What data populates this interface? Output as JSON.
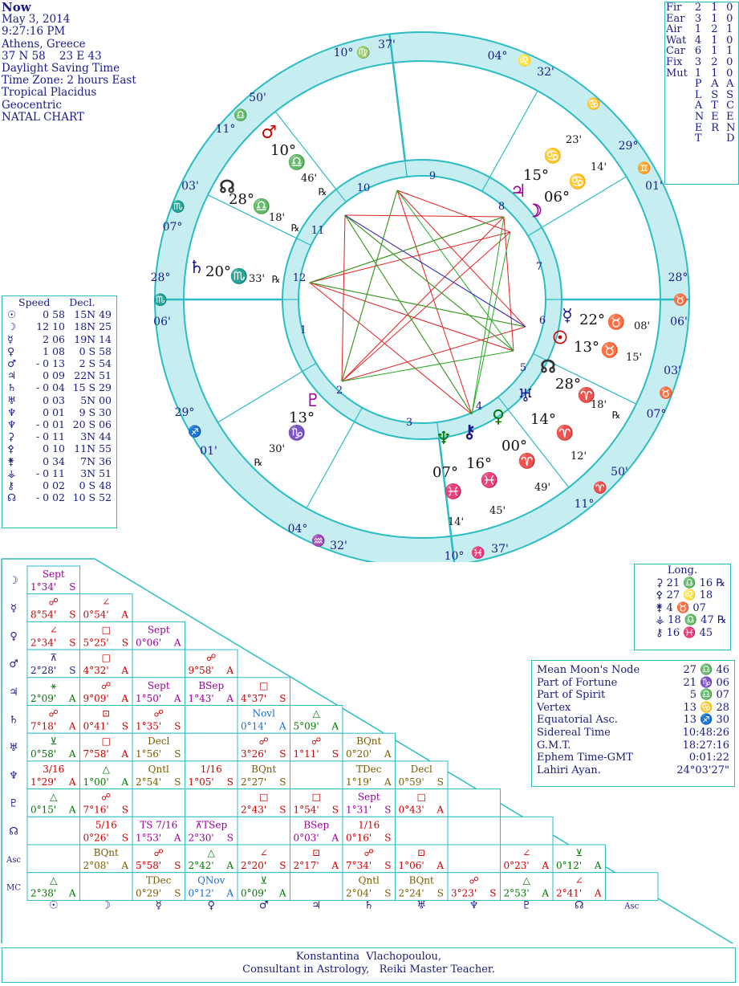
{
  "info": {
    "title": "Now",
    "lines": [
      "May 3, 2014",
      "9:27:16 PM",
      "Athens, Greece",
      "37 N 58    23 E 43",
      "Daylight Saving Time",
      "Time Zone: 2 hours East",
      "Tropical Placidus",
      "Geocentric",
      "NATAL CHART"
    ]
  },
  "elements": {
    "rows": [
      {
        "label": "Fir",
        "a": "2",
        "b": "1",
        "c": "0"
      },
      {
        "label": "Ear",
        "a": "3",
        "b": "1",
        "c": "0"
      },
      {
        "label": "Air",
        "a": "1",
        "b": "2",
        "c": "1"
      },
      {
        "label": "Wat",
        "a": "4",
        "b": "1",
        "c": "0"
      },
      {
        "label": "Car",
        "a": "6",
        "b": "1",
        "c": "1"
      },
      {
        "label": "Fix",
        "a": "3",
        "b": "2",
        "c": "0"
      },
      {
        "label": "Mut",
        "a": "1",
        "b": "1",
        "c": "0"
      }
    ],
    "planet_letters": [
      "P",
      "L",
      "A",
      "N",
      "E",
      "T"
    ],
    "aster_letters": [
      "A",
      "S",
      "T",
      "E",
      "R"
    ],
    "ascend_letters": [
      "A",
      "S",
      "C",
      "E",
      "N",
      "D"
    ]
  },
  "wheel": {
    "outer_labels": [
      {
        "text": "10° ♍ 37'",
        "color": "#1a1a8a"
      },
      {
        "text": "04° ♌ 32'",
        "color": "#1a1a8a"
      },
      {
        "text": "29° ♊ 01'",
        "color": "#1a1a8a"
      },
      {
        "text": "28° ♉ 06'",
        "color": "#1a1a8a"
      },
      {
        "text": "03' ♉ 07°",
        "color": "#1a1a8a"
      },
      {
        "text": "50' ♈ 11°",
        "color": "#1a1a8a"
      },
      {
        "text": "10° ♓ 37'",
        "color": "#1a1a8a"
      },
      {
        "text": "04° ♒ 32'",
        "color": "#1a1a8a"
      },
      {
        "text": "29° ♐ 01'",
        "color": "#1a1a8a"
      },
      {
        "text": "28° ♏ 06'",
        "color": "#1a1a8a"
      },
      {
        "text": "03' ♏ 07°",
        "color": "#1a1a8a"
      },
      {
        "text": "50' ♎ 11°",
        "color": "#1a1a8a"
      }
    ],
    "cusp_texts": [
      "10°",
      "♍",
      "37'",
      "04°",
      "♌",
      "32'",
      "♋",
      "29°",
      "♊",
      "01'",
      "28°",
      "♉",
      "06'",
      "03'",
      "♉",
      "07°",
      "50'",
      "♈",
      "11°",
      "10°",
      "♓",
      "37'",
      "04°",
      "♒",
      "32'",
      "29°",
      "♐",
      "01'",
      "28°",
      "♏",
      "06'",
      "03'",
      "♏",
      "07°",
      "50'",
      "♎",
      "11°"
    ],
    "house_numbers": [
      "1",
      "2",
      "3",
      "4",
      "5",
      "6",
      "7",
      "8",
      "9",
      "10",
      "11",
      "12"
    ],
    "planets": [
      {
        "glyph": "♂",
        "deg": "10°",
        "sign": "♎",
        "min": "46'",
        "retro": "℞",
        "color": "#cc0000"
      },
      {
        "glyph": "☊",
        "deg": "28°",
        "sign": "♎",
        "min": "18'",
        "retro": "℞",
        "color": "#333333"
      },
      {
        "glyph": "♄",
        "deg": "20°",
        "sign": "♏",
        "min": "33'",
        "retro": "℞",
        "color": "#1a1a8a"
      },
      {
        "glyph": "♇",
        "deg": "13°",
        "sign": "♑",
        "min": "30'",
        "retro": "℞",
        "color": "#990099"
      },
      {
        "glyph": "♆",
        "deg": "07°",
        "sign": "♓",
        "min": "14'",
        "retro": "",
        "color": "#007700"
      },
      {
        "glyph": "⚷",
        "deg": "16°",
        "sign": "♓",
        "min": "45'",
        "retro": "",
        "color": "#1a1a8a"
      },
      {
        "glyph": "♀",
        "deg": "00°",
        "sign": "♈",
        "min": "49'",
        "retro": "",
        "color": "#007700"
      },
      {
        "glyph": "♅",
        "deg": "14°",
        "sign": "♈",
        "min": "12'",
        "retro": "",
        "color": "#1a1a8a"
      },
      {
        "glyph": "☊",
        "deg": "28°",
        "sign": "♈",
        "min": "18'",
        "retro": "℞",
        "color": "#333333"
      },
      {
        "glyph": "☉",
        "deg": "13°",
        "sign": "♉",
        "min": "15'",
        "retro": "",
        "color": "#cc0000"
      },
      {
        "glyph": "☿",
        "deg": "22°",
        "sign": "♉",
        "min": "08'",
        "retro": "",
        "color": "#1a1a8a"
      },
      {
        "glyph": "☽",
        "deg": "06°",
        "sign": "♋",
        "min": "14'",
        "retro": "",
        "color": "#990099"
      },
      {
        "glyph": "♃",
        "deg": "15°",
        "sign": "♋",
        "min": "23'",
        "retro": "",
        "color": "#990099"
      }
    ]
  },
  "speed": {
    "headers": [
      "Speed",
      "Decl."
    ],
    "rows": [
      {
        "glyph": "☉",
        "speed": "0 58",
        "decl": "15N 49"
      },
      {
        "glyph": "☽",
        "speed": "12 10",
        "decl": "18N 25"
      },
      {
        "glyph": "☿",
        "speed": "2 06",
        "decl": "19N 14"
      },
      {
        "glyph": "♀",
        "speed": "1 08",
        "decl": "0 S 58"
      },
      {
        "glyph": "♂",
        "speed": "- 0 13",
        "decl": "2 S 54"
      },
      {
        "glyph": "♃",
        "speed": "0 09",
        "decl": "22N 51"
      },
      {
        "glyph": "♄",
        "speed": "- 0 04",
        "decl": "15 S 29"
      },
      {
        "glyph": "♅",
        "speed": "0 03",
        "decl": "5N 00"
      },
      {
        "glyph": "♆",
        "speed": "0 01",
        "decl": "9 S 30"
      },
      {
        "glyph": "♆",
        "speed": "- 0 01",
        "decl": "20 S 06"
      },
      {
        "glyph": "⚳",
        "speed": "- 0 11",
        "decl": "3N 44"
      },
      {
        "glyph": "⚴",
        "speed": "0 10",
        "decl": "11N 55"
      },
      {
        "glyph": "⚵",
        "speed": "0 34",
        "decl": "7N 36"
      },
      {
        "glyph": "⚶",
        "speed": "- 0 11",
        "decl": "3N 51"
      },
      {
        "glyph": "⚷",
        "speed": "0 02",
        "decl": "0 S 48"
      },
      {
        "glyph": "☊",
        "speed": "- 0 02",
        "decl": "10 S 52"
      }
    ]
  },
  "long": {
    "title": "Long.",
    "rows": [
      {
        "glyph": "⚳",
        "value": "21 ♎ 16 ℞"
      },
      {
        "glyph": "⚴",
        "value": "27 ♌ 18"
      },
      {
        "glyph": "⚵",
        "value": "4 ♉ 07"
      },
      {
        "glyph": "⚶",
        "value": "18 ♎ 47 ℞"
      },
      {
        "glyph": "⚷",
        "value": "16 ♓ 45"
      }
    ]
  },
  "misc": [
    {
      "label": "Mean Moon's Node",
      "value": "27 ♎ 46"
    },
    {
      "label": "Part of Fortune",
      "value": "21 ♑ 06"
    },
    {
      "label": "Part of Spirit",
      "value": "5 ♎ 07"
    },
    {
      "label": "Vertex",
      "value": "13 ♋ 28"
    },
    {
      "label": "Equatorial Asc.",
      "value": "13 ♐ 30"
    },
    {
      "label": "Sidereal Time",
      "value": "10:48:26"
    },
    {
      "label": "G.M.T.",
      "value": "18:27:16"
    },
    {
      "label": "Ephem Time-GMT",
      "value": "0:01:22"
    },
    {
      "label": "Lahiri Ayan.",
      "value": "24°03'27\""
    }
  ],
  "aspect_grid": {
    "row_glyphs": [
      "☽",
      "☿",
      "♀",
      "♂",
      "♃",
      "♄",
      "♅",
      "♆",
      "♇",
      "☊",
      "Asc",
      "MC"
    ],
    "col_glyphs": [
      "☉",
      "☽",
      "☿",
      "♀",
      "♂",
      "♃",
      "♄",
      "♅",
      "♆",
      "♇",
      "☊",
      "Asc"
    ],
    "cells": [
      [
        {
          "a": "Sept",
          "o": "1°34'",
          "t": "S",
          "c": "#990099"
        }
      ],
      [
        {
          "a": "☍",
          "o": "8°54'",
          "t": "S",
          "c": "#cc0000"
        },
        {
          "a": "∠",
          "o": "0°54'",
          "t": "A",
          "c": "#cc0000"
        }
      ],
      [
        {
          "a": "∠",
          "o": "2°34'",
          "t": "S",
          "c": "#cc0000"
        },
        {
          "a": "□",
          "o": "5°25'",
          "t": "S",
          "c": "#cc0000"
        },
        {
          "a": "Sept",
          "o": "0°06'",
          "t": "A",
          "c": "#990099"
        }
      ],
      [
        {
          "a": "⊼",
          "o": "2°28'",
          "t": "S",
          "c": "#1a1a8a"
        },
        {
          "a": "□",
          "o": "4°32'",
          "t": "A",
          "c": "#cc0000"
        },
        null,
        {
          "a": "☍",
          "o": "9°58'",
          "t": "A",
          "c": "#cc0000"
        }
      ],
      [
        {
          "a": "⚹",
          "o": "2°09'",
          "t": "A",
          "c": "#007700"
        },
        {
          "a": "☍",
          "o": "9°09'",
          "t": "A",
          "c": "#cc0000"
        },
        {
          "a": "Sept",
          "o": "1°50'",
          "t": "A",
          "c": "#990099"
        },
        {
          "a": "BSep",
          "o": "1°43'",
          "t": "A",
          "c": "#990099"
        },
        {
          "a": "□",
          "o": "4°37'",
          "t": "S",
          "c": "#cc0000"
        }
      ],
      [
        {
          "a": "☍",
          "o": "7°18'",
          "t": "A",
          "c": "#cc0000"
        },
        {
          "a": "⊡",
          "o": "0°41'",
          "t": "S",
          "c": "#cc0000"
        },
        {
          "a": "☍",
          "o": "1°35'",
          "t": "S",
          "c": "#cc0000"
        },
        null,
        {
          "a": "Novl",
          "o": "0°14'",
          "t": "A",
          "c": "#1a6acc"
        },
        {
          "a": "△",
          "o": "5°09'",
          "t": "A",
          "c": "#007700"
        }
      ],
      [
        {
          "a": "⊻",
          "o": "0°58'",
          "t": "A",
          "c": "#007700"
        },
        {
          "a": "□",
          "o": "7°58'",
          "t": "A",
          "c": "#cc0000"
        },
        {
          "a": "Decl",
          "o": "1°56'",
          "t": "S",
          "c": "#7a5a00"
        },
        null,
        {
          "a": "☍",
          "o": "3°26'",
          "t": "S",
          "c": "#cc0000"
        },
        {
          "a": "☍",
          "o": "1°11'",
          "t": "S",
          "c": "#cc0000"
        },
        {
          "a": "BQnt",
          "o": "0°20'",
          "t": "A",
          "c": "#7a5a00"
        }
      ],
      [
        {
          "a": "3/16",
          "o": "1°29'",
          "t": "A",
          "c": "#cc0000"
        },
        {
          "a": "△",
          "o": "1°00'",
          "t": "A",
          "c": "#007700"
        },
        {
          "a": "Qntl",
          "o": "2°54'",
          "t": "S",
          "c": "#7a5a00"
        },
        {
          "a": "1/16",
          "o": "1°05'",
          "t": "S",
          "c": "#cc0000"
        },
        {
          "a": "BQnt",
          "o": "2°27'",
          "t": "S",
          "c": "#7a5a00"
        },
        null,
        {
          "a": "TDec",
          "o": "1°19'",
          "t": "A",
          "c": "#7a5a00"
        },
        {
          "a": "Decl",
          "o": "0°59'",
          "t": "S",
          "c": "#7a5a00"
        }
      ],
      [
        {
          "a": "△",
          "o": "0°15'",
          "t": "A",
          "c": "#007700"
        },
        {
          "a": "☍",
          "o": "7°16'",
          "t": "S",
          "c": "#cc0000"
        },
        null,
        null,
        {
          "a": "□",
          "o": "2°43'",
          "t": "S",
          "c": "#cc0000"
        },
        {
          "a": "□",
          "o": "1°54'",
          "t": "S",
          "c": "#cc0000"
        },
        {
          "a": "Sept",
          "o": "1°31'",
          "t": "S",
          "c": "#990099"
        },
        {
          "a": "□",
          "o": "0°43'",
          "t": "A",
          "c": "#cc0000"
        }
      ],
      [
        null,
        {
          "a": "5/16",
          "o": "0°26'",
          "t": "S",
          "c": "#cc0000"
        },
        {
          "a": "TS  7/16",
          "o": "1°53'",
          "t": "A",
          "c": "#990099"
        },
        {
          "a": "⊼TSep",
          "o": "2°30'",
          "t": "S",
          "c": "#990099"
        },
        null,
        {
          "a": "BSep",
          "o": "0°03'",
          "t": "A",
          "c": "#990099"
        },
        {
          "a": "1/16",
          "o": "0°16'",
          "t": "S",
          "c": "#cc0000"
        }
      ],
      [
        null,
        {
          "a": "BQnt",
          "o": "2°08'",
          "t": "A",
          "c": "#7a5a00"
        },
        {
          "a": "☍",
          "o": "5°58'",
          "t": "S",
          "c": "#cc0000"
        },
        {
          "a": "△",
          "o": "2°42'",
          "t": "A",
          "c": "#007700"
        },
        {
          "a": "∠",
          "o": "2°20'",
          "t": "S",
          "c": "#cc0000"
        },
        {
          "a": "⊡",
          "o": "2°17'",
          "t": "A",
          "c": "#cc0000"
        },
        {
          "a": "☍",
          "o": "7°34'",
          "t": "S",
          "c": "#cc0000"
        },
        {
          "a": "⊡",
          "o": "1°06'",
          "t": "A",
          "c": "#cc0000"
        },
        null,
        {
          "a": "∠",
          "o": "0°23'",
          "t": "A",
          "c": "#cc0000"
        },
        {
          "a": "⊻",
          "o": "0°12'",
          "t": "A",
          "c": "#007700"
        }
      ],
      [
        {
          "a": "△",
          "o": "2°38'",
          "t": "A",
          "c": "#007700"
        },
        null,
        {
          "a": "TDec",
          "o": "0°29'",
          "t": "S",
          "c": "#7a5a00"
        },
        {
          "a": "QNov",
          "o": "0°12'",
          "t": "A",
          "c": "#1a6acc"
        },
        {
          "a": "⊻",
          "o": "0°09'",
          "t": "A",
          "c": "#007700"
        },
        null,
        {
          "a": "Qntl",
          "o": "2°04'",
          "t": "S",
          "c": "#7a5a00"
        },
        {
          "a": "BQnt",
          "o": "2°24'",
          "t": "S",
          "c": "#7a5a00"
        },
        {
          "a": "☍",
          "o": "3°23'",
          "t": "S",
          "c": "#cc0000"
        },
        {
          "a": "△",
          "o": "2°53'",
          "t": "A",
          "c": "#007700"
        },
        {
          "a": "∠",
          "o": "2°41'",
          "t": "A",
          "c": "#cc0000"
        }
      ]
    ]
  },
  "footer": {
    "line1": "Konstantina  Vlachopoulou,",
    "line2": "Consultant in Astrology,   Reiki Master Teacher."
  }
}
